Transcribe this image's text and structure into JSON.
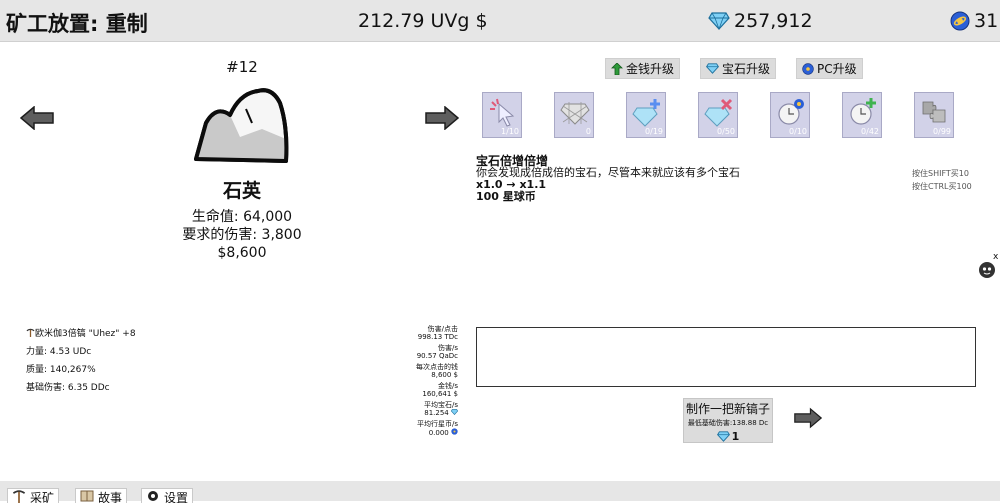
{
  "header": {
    "title": "矿工放置: 重制",
    "money": "212.79 UVg $",
    "gems": "257,912",
    "coins": "31"
  },
  "rock": {
    "number": "#12",
    "name": "石英",
    "hp": "生命值: 64,000",
    "damage_required": "要求的伤害: 3,800",
    "reward": "$8,600"
  },
  "upgrade_tabs": [
    {
      "label": "金钱升级",
      "icon": "money-up-icon"
    },
    {
      "label": "宝石升级",
      "icon": "gem-icon"
    },
    {
      "label": "PC升级",
      "icon": "planet-coin-icon"
    }
  ],
  "upgrades": [
    {
      "level": "1/10",
      "icon": "cursor-icon"
    },
    {
      "level": "0",
      "icon": "gem-net-icon"
    },
    {
      "level": "0/19",
      "icon": "gem-plus-icon"
    },
    {
      "level": "0/50",
      "icon": "gem-multiply-icon"
    },
    {
      "level": "0/10",
      "icon": "clock-coin-icon"
    },
    {
      "level": "0/42",
      "icon": "clock-plus-icon"
    },
    {
      "level": "0/99",
      "icon": "puzzle-icon"
    }
  ],
  "selected_upgrade": {
    "title": "宝石倍增倍增",
    "description": "你会发现成倍成倍的宝石，尽管本来就应该有多个宝石",
    "effect": "x1.0 → x1.1",
    "cost": "100 星球币"
  },
  "hints": {
    "shift": "按住SHIFT买10",
    "ctrl": "按住CTRL买100"
  },
  "pickaxe": {
    "name": "欧米伽3倍镐 \"Uhez\" +8",
    "power": "力量: 4.53 UDc",
    "quality": "质量: 140,267%",
    "base_damage": "基础伤害: 6.35 DDc"
  },
  "mining_stats": [
    {
      "label": "伤害/点击",
      "value": "998.13 TDc"
    },
    {
      "label": "伤害/s",
      "value": "90.57 QaDc"
    },
    {
      "label": "每次点击的钱",
      "value": "8,600 $"
    },
    {
      "label": "金钱/s",
      "value": "160,641 $"
    },
    {
      "label": "平均宝石/s",
      "value": "81.254"
    },
    {
      "label": "平均行星币/s",
      "value": "0.000"
    }
  ],
  "craft": {
    "label": "制作一把新镐子",
    "min_damage": "最低基础伤害:138.88 Dc",
    "cost": "1"
  },
  "bottom_tabs": [
    {
      "label": "采矿",
      "icon": "pickaxe-icon"
    },
    {
      "label": "故事",
      "icon": "book-icon"
    },
    {
      "label": "设置",
      "icon": "gear-icon"
    }
  ],
  "helper_close": "x",
  "colors": {
    "topbar_bg": "#e6e6e6",
    "card_bg": "#d2d2e8",
    "gem": "#3fa7e0",
    "coin": "#2b5fd6"
  }
}
